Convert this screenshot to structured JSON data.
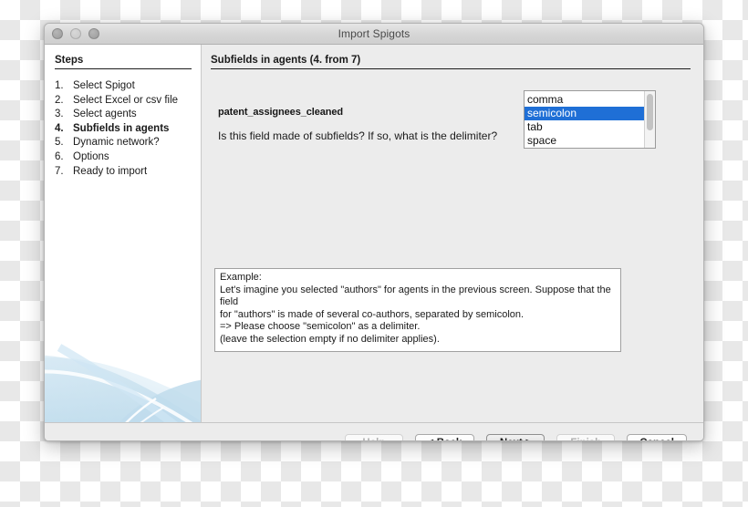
{
  "window": {
    "title": "Import Spigots",
    "traffic_lights": [
      "close-button",
      "minimize-button",
      "maximize-button"
    ]
  },
  "sidebar": {
    "heading": "Steps",
    "items": [
      {
        "num": "1.",
        "label": "Select Spigot",
        "current": false
      },
      {
        "num": "2.",
        "label": "Select Excel or csv file",
        "current": false
      },
      {
        "num": "3.",
        "label": "Select agents",
        "current": false
      },
      {
        "num": "4.",
        "label": "Subfields in agents",
        "current": true
      },
      {
        "num": "5.",
        "label": "Dynamic network?",
        "current": false
      },
      {
        "num": "6.",
        "label": "Options",
        "current": false
      },
      {
        "num": "7.",
        "label": "Ready to import",
        "current": false
      }
    ]
  },
  "content": {
    "heading": "Subfields in agents (4. from 7)",
    "field_name": "patent_assignees_cleaned",
    "question": "Is this field made of subfields? If so, what is the delimiter?",
    "delimiter_list": {
      "options": [
        "comma",
        "semicolon",
        "tab",
        "space"
      ],
      "selected": "semicolon",
      "selected_color": "#1f6fd6"
    },
    "example": {
      "line1": "Example:",
      "line2": "Let's imagine you selected \"authors\" for agents in the previous screen. Suppose that the field",
      "line3": "for \"authors\" is made of several co-authors, separated by semicolon.",
      "line4": "=> Please choose \"semicolon\" as a delimiter.",
      "line5": "(leave the selection empty if no delimiter applies)."
    }
  },
  "buttons": {
    "help": "Help",
    "back": "< Back",
    "next": "Next >",
    "finish": "Finish",
    "cancel": "Cancel"
  }
}
